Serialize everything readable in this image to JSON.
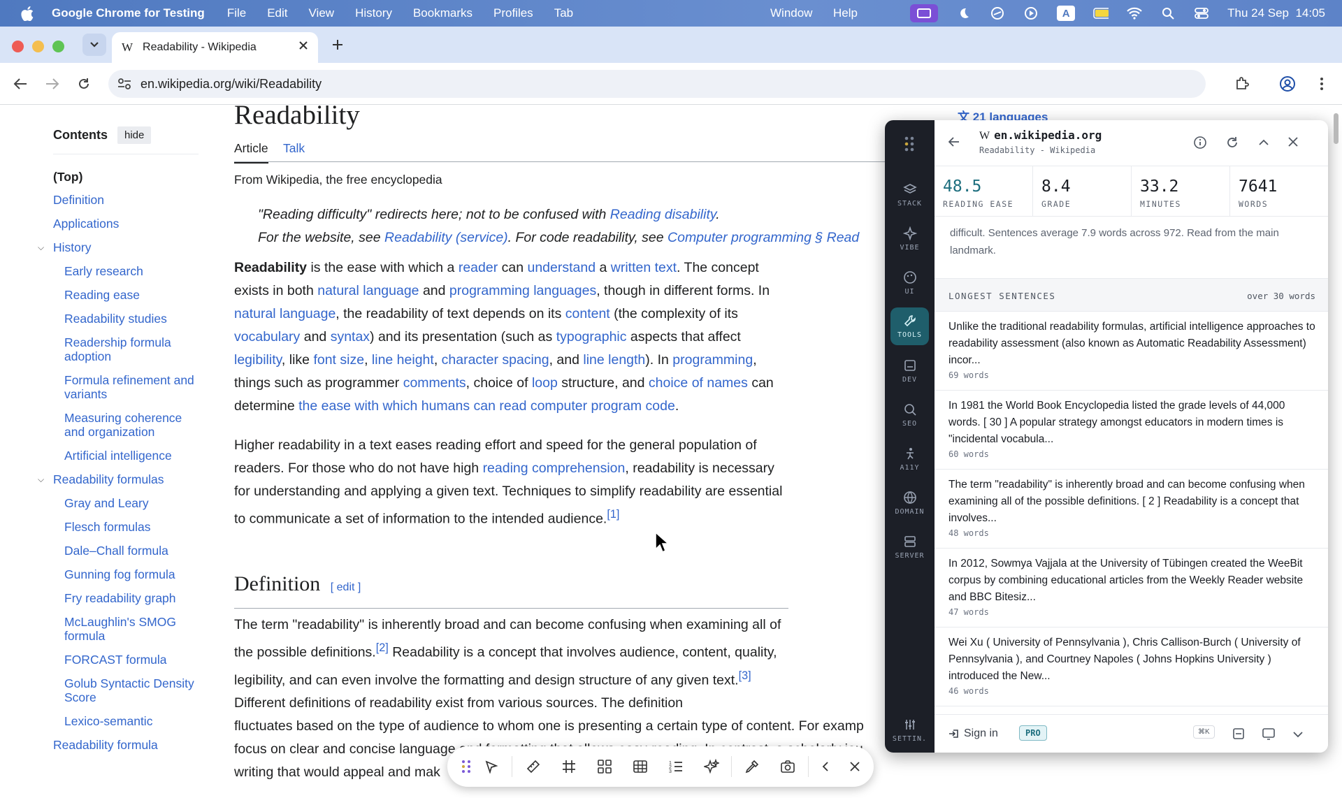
{
  "menubar": {
    "app_name": "Google Chrome for Testing",
    "items": [
      "File",
      "Edit",
      "View",
      "History",
      "Bookmarks",
      "Profiles",
      "Tab",
      "Window",
      "Help"
    ],
    "clock": "Thu 24 Sep  14:05"
  },
  "browser": {
    "tab_title": "Readability - Wikipedia",
    "tab_favicon": "W",
    "url": "en.wikipedia.org/wiki/Readability"
  },
  "toc": {
    "header": "Contents",
    "hide": "hide",
    "items": [
      {
        "label": "(Top)"
      },
      {
        "label": "Definition"
      },
      {
        "label": "Applications"
      },
      {
        "label": "History"
      },
      {
        "label": "Early research"
      },
      {
        "label": "Reading ease"
      },
      {
        "label": "Readability studies"
      },
      {
        "label": "Readership formula adoption"
      },
      {
        "label": "Formula refinement and variants"
      },
      {
        "label": "Measuring coherence and organization"
      },
      {
        "label": "Artificial intelligence"
      },
      {
        "label": "Readability formulas"
      },
      {
        "label": "Gray and Leary"
      },
      {
        "label": "Flesch formulas"
      },
      {
        "label": "Dale–Chall formula"
      },
      {
        "label": "Gunning fog formula"
      },
      {
        "label": "Fry readability graph"
      },
      {
        "label": "McLaughlin's SMOG formula"
      },
      {
        "label": "FORCAST formula"
      },
      {
        "label": "Golub Syntactic Density Score"
      },
      {
        "label": "Lexico-semantic"
      },
      {
        "label": "Readability formula"
      }
    ]
  },
  "article": {
    "title": "Readability",
    "languages": "21 languages",
    "tab_article": "Article",
    "tab_talk": "Talk",
    "tagline": "From Wikipedia, the free encyclopedia",
    "hatnote1_pre": "\"Reading difficulty\" redirects here; not to be confused with ",
    "hatnote1_link": "Reading disability",
    "hatnote1_post": ".",
    "hatnote2_pre": "For the website, see ",
    "hatnote2_link1": "Readability (service)",
    "hatnote2_mid": ". For code readability, see ",
    "hatnote2_link2": "Computer programming § Read",
    "definition_heading": "Definition",
    "edit_label": "[ edit ]"
  },
  "panel": {
    "domain": "en.wikipedia.org",
    "page_title": "Readability - Wikipedia",
    "rail": [
      "STACK",
      "VIBE",
      "UI",
      "TOOLS",
      "DEV",
      "SEO",
      "A11Y",
      "DOMAIN",
      "SERVER",
      "SETTIN."
    ],
    "stats": [
      {
        "value": "48.5",
        "label": "READING EASE"
      },
      {
        "value": "8.4",
        "label": "GRADE"
      },
      {
        "value": "33.2",
        "label": "MINUTES"
      },
      {
        "value": "7641",
        "label": "WORDS"
      }
    ],
    "description": "difficult. Sentences average 7.9 words across 972. Read from the main landmark.",
    "longest_header": "LONGEST SENTENCES",
    "longest_threshold": "over 30 words",
    "sentences": [
      {
        "text": "Unlike the traditional readability formulas, artificial intelligence approaches to readability assessment (also known as Automatic Readability Assessment) incor...",
        "words": "69 words"
      },
      {
        "text": "In 1981 the World Book Encyclopedia listed the grade levels of 44,000 words. [ 30 ] A popular strategy amongst educators in modern times is \"incidental vocabula...",
        "words": "60 words"
      },
      {
        "text": "The term \"readability\" is inherently broad and can become confusing when examining all of the possible definitions. [ 2 ] Readability is a concept that involves...",
        "words": "48 words"
      },
      {
        "text": "In 2012, Sowmya Vajjala at the University of Tübingen created the WeeBit corpus by combining educational articles from the Weekly Reader website and BBC Bitesiz...",
        "words": "47 words"
      },
      {
        "text": "Wei Xu ( University of Pennsylvania ), Chris Callison-Burch ( University of Pennsylvania ), and Courtney Napoles ( Johns Hopkins University ) introduced the New...",
        "words": "46 words"
      }
    ],
    "sign_in": "Sign in",
    "pro_badge": "PRO",
    "shortcut": "⌘K"
  },
  "colors": {
    "link": "#3366cc",
    "accent_teal": "#1d6e7e",
    "rail_bg": "#1c1f27"
  }
}
